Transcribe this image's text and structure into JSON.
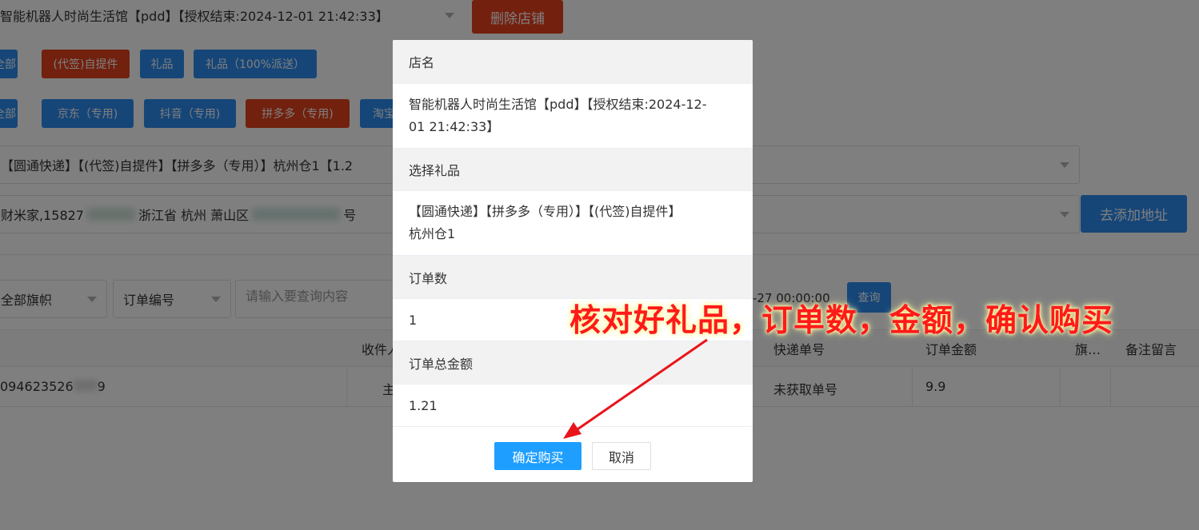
{
  "background": {
    "shop_select": "智能机器人时尚生活馆【pdd】【授权结束:2024-12-01 21:42:33】",
    "delete_shop": "删除店铺",
    "row1_tags": [
      "全部",
      "(代签)自提件",
      "礼品",
      "礼品（100%派送）"
    ],
    "row2_tags": [
      "全部",
      "京东（专用)",
      "抖音（专用)",
      "拼多多（专用)",
      "淘宝"
    ],
    "gift_select": "【圆通快递】【(代签)自提件】【拼多多（专用）】杭州仓1【1.2",
    "address_select_parts": [
      "财米家,15827",
      "浙江省 杭州 萧山区",
      "号"
    ],
    "add_address": "去添加地址",
    "filter_flag": "全部旗帜",
    "filter_field": "订单编号",
    "search_placeholder": "请输入要查询内容",
    "date_text": "-27 00:00:00",
    "query_button": "查询",
    "table_headers": [
      "收件人",
      "快递单号",
      "订单金额",
      "旗…",
      "备注留言"
    ],
    "row": {
      "order_no": "094623526",
      "order_no_tail": "9",
      "recipient": "主",
      "tracking": "未获取单号",
      "amount": "9.9"
    }
  },
  "modal": {
    "shop_label": "店名",
    "shop_value_line1": "智能机器人时尚生活馆【pdd】【授权结束:2024-12-",
    "shop_value_line2": "01 21:42:33】",
    "gift_label": "选择礼品",
    "gift_value_line1": "【圆通快递】【拼多多（专用）】【(代签)自提件】",
    "gift_value_line2": "杭州仓1",
    "order_count_label": "订单数",
    "order_count_value": "1",
    "total_label": "订单总金额",
    "total_value": "1.21",
    "confirm": "确定购买",
    "cancel": "取消"
  },
  "annotation": {
    "text": "核对好礼品，订单数，金额，确认购买",
    "color": "#ff1a1a"
  },
  "colors": {
    "primary": "#2d8cf0",
    "danger": "#e8401f",
    "confirm": "#1e9fff"
  }
}
